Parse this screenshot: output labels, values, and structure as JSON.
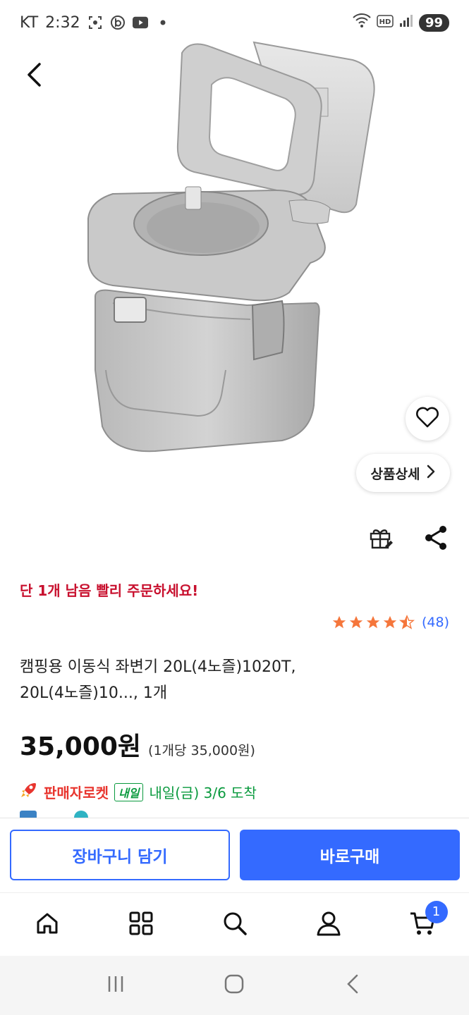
{
  "status_bar": {
    "carrier": "KT",
    "time": "2:32",
    "battery": "99"
  },
  "product": {
    "urgent_notice": "단 1개 남음 빨리 주문하세요!",
    "rating_value": 4.5,
    "review_count": "(48)",
    "title_line1": "캠핑용 이동식 좌변기 20L(4노즐)1020T,",
    "title_line2": "20L(4노즐)10..., 1개",
    "price": "35,000원",
    "unit_price": "(1개당 35,000원)",
    "detail_label": "상품상세",
    "image_icon": "portable-toilet-image"
  },
  "delivery": {
    "rocket_label": "판매자로켓",
    "tomorrow_badge": "내일",
    "arrival": "내일(금) 3/6 도착"
  },
  "actions": {
    "cart_label": "장바구니 담기",
    "buy_label": "바로구매"
  },
  "bottom_nav": {
    "cart_count": "1",
    "items": [
      "home-icon",
      "category-icon",
      "search-icon",
      "my-page-icon",
      "cart-icon"
    ]
  },
  "colors": {
    "accent": "#346aff",
    "urgent": "#c8102e",
    "star": "#f5763b",
    "delivery": "#0a9a3e"
  }
}
